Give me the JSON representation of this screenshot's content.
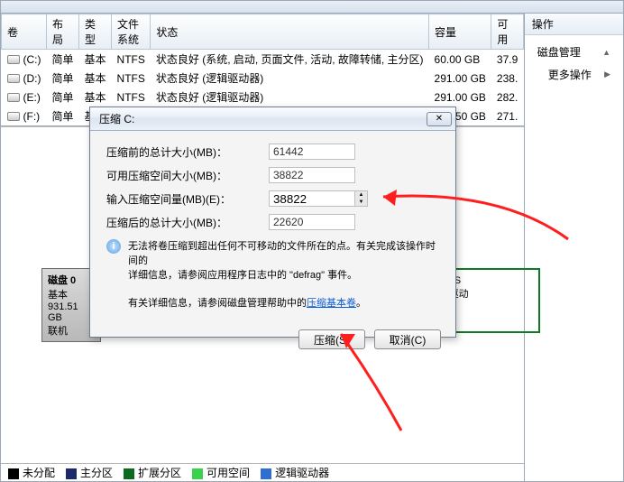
{
  "columns": {
    "vol": "卷",
    "layout": "布局",
    "type": "类型",
    "fs": "文件系统",
    "status": "状态",
    "capacity": "容量",
    "avail": "可用"
  },
  "volumes": [
    {
      "drive": "(C:)",
      "layout": "简单",
      "type": "基本",
      "fs": "NTFS",
      "status": "状态良好 (系统, 启动, 页面文件, 活动, 故障转储, 主分区)",
      "capacity": "60.00 GB",
      "avail": "37.9"
    },
    {
      "drive": "(D:)",
      "layout": "简单",
      "type": "基本",
      "fs": "NTFS",
      "status": "状态良好 (逻辑驱动器)",
      "capacity": "291.00 GB",
      "avail": "238."
    },
    {
      "drive": "(E:)",
      "layout": "简单",
      "type": "基本",
      "fs": "NTFS",
      "status": "状态良好 (逻辑驱动器)",
      "capacity": "291.00 GB",
      "avail": "282."
    },
    {
      "drive": "(F:)",
      "layout": "简单",
      "type": "基本",
      "fs": "NTFS",
      "status": "状态良好 (逻辑驱动器)",
      "capacity": "289.50 GB",
      "avail": "271."
    }
  ],
  "actions": {
    "header": "操作",
    "diskmgmt": "磁盘管理",
    "more": "更多操作"
  },
  "disk_info": {
    "title": "磁盘 0",
    "type": "基本",
    "size": "931.51 GB",
    "state": "联机"
  },
  "partition": {
    "fs": "B NTFS",
    "kind": "(逻辑驱动"
  },
  "dialog": {
    "title": "压缩 C:",
    "fld1": "压缩前的总计大小(MB)：",
    "val1": "61442",
    "fld2": "可用压缩空间大小(MB)：",
    "val2": "38822",
    "fld3": "输入压缩空间量(MB)(E)：",
    "val3": "38822",
    "fld4": "压缩后的总计大小(MB)：",
    "val4": "22620",
    "info1": "无法将卷压缩到超出任何不可移动的文件所在的点。有关完成该操作时间的",
    "info2": "详细信息，请参阅应用程序日志中的 \"defrag\" 事件。",
    "more_pre": "有关详细信息，请参阅磁盘管理帮助中的",
    "more_link": "压缩基本卷",
    "more_post": "。",
    "btn_shrink": "压缩(S)",
    "btn_cancel": "取消(C)"
  },
  "legend": {
    "unalloc": "未分配",
    "primary": "主分区",
    "extended": "扩展分区",
    "free": "可用空间",
    "logical": "逻辑驱动器"
  },
  "colors": {
    "unalloc": "#000000",
    "primary": "#1c2a6b",
    "extended": "#0c6b1e",
    "free": "#39d24c",
    "logical": "#2f6fd4"
  }
}
